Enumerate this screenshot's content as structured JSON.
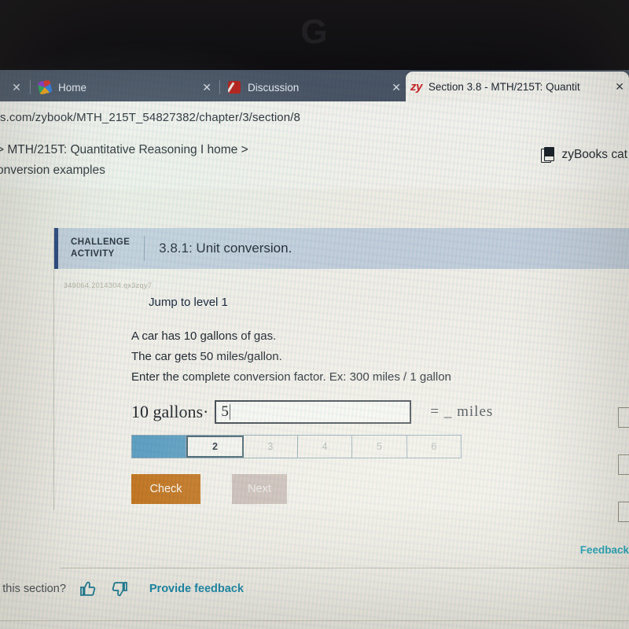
{
  "browser": {
    "tabs": [
      {
        "title": "",
        "favicon": "none",
        "close_label": "✕",
        "state": "partial"
      },
      {
        "title": "Home",
        "favicon": "pinwheel-favicon",
        "close_label": "✕",
        "state": "inactive"
      },
      {
        "title": "Discussion",
        "favicon": "canvas-favicon",
        "close_label": "✕",
        "state": "inactive"
      },
      {
        "title": "Section 3.8 - MTH/215T: Quantit",
        "favicon": "zy-favicon",
        "favicon_text": "zy",
        "close_label": "✕",
        "state": "active"
      }
    ],
    "url": "s.com/zybook/MTH_215T_54827382/chapter/3/section/8"
  },
  "page_header": {
    "breadcrumb_line1": "> MTH/215T: Quantitative Reasoning I home >",
    "breadcrumb_line2": "onversion examples",
    "catalog_label": "zyBooks cat"
  },
  "activity": {
    "badge_line1": "CHALLENGE",
    "badge_line2": "ACTIVITY",
    "title": "3.8.1: Unit conversion.",
    "activity_id": "349064.2014304.qx3zqy7",
    "jump_label": "Jump to level 1",
    "question_line1": "A car has 10 gallons of gas.",
    "question_line2": "The car gets 50 miles/gallon.",
    "question_line3": "Enter the complete conversion factor. Ex: 300 miles / 1 gallon",
    "math_lead": "10 gallons·",
    "answer_value": "5",
    "math_tail": "=  _  miles",
    "progress": {
      "segments": [
        "",
        "2",
        "3",
        "4",
        "5",
        "6"
      ],
      "completed": 1,
      "current_index": 1,
      "fill_color": "#5a9cc0"
    },
    "check_label": "Check",
    "next_label": "Next",
    "check_color": "#c2731e",
    "next_color": "#c9bbb5"
  },
  "footer": {
    "feedback_right": "Feedback",
    "section_question": "s this section?",
    "thumbs_up_icon": "👍",
    "thumbs_down_icon": "👎",
    "provide_feedback": "Provide feedback",
    "link_color": "#1888a8"
  },
  "bezel": {
    "watermark": "G"
  }
}
